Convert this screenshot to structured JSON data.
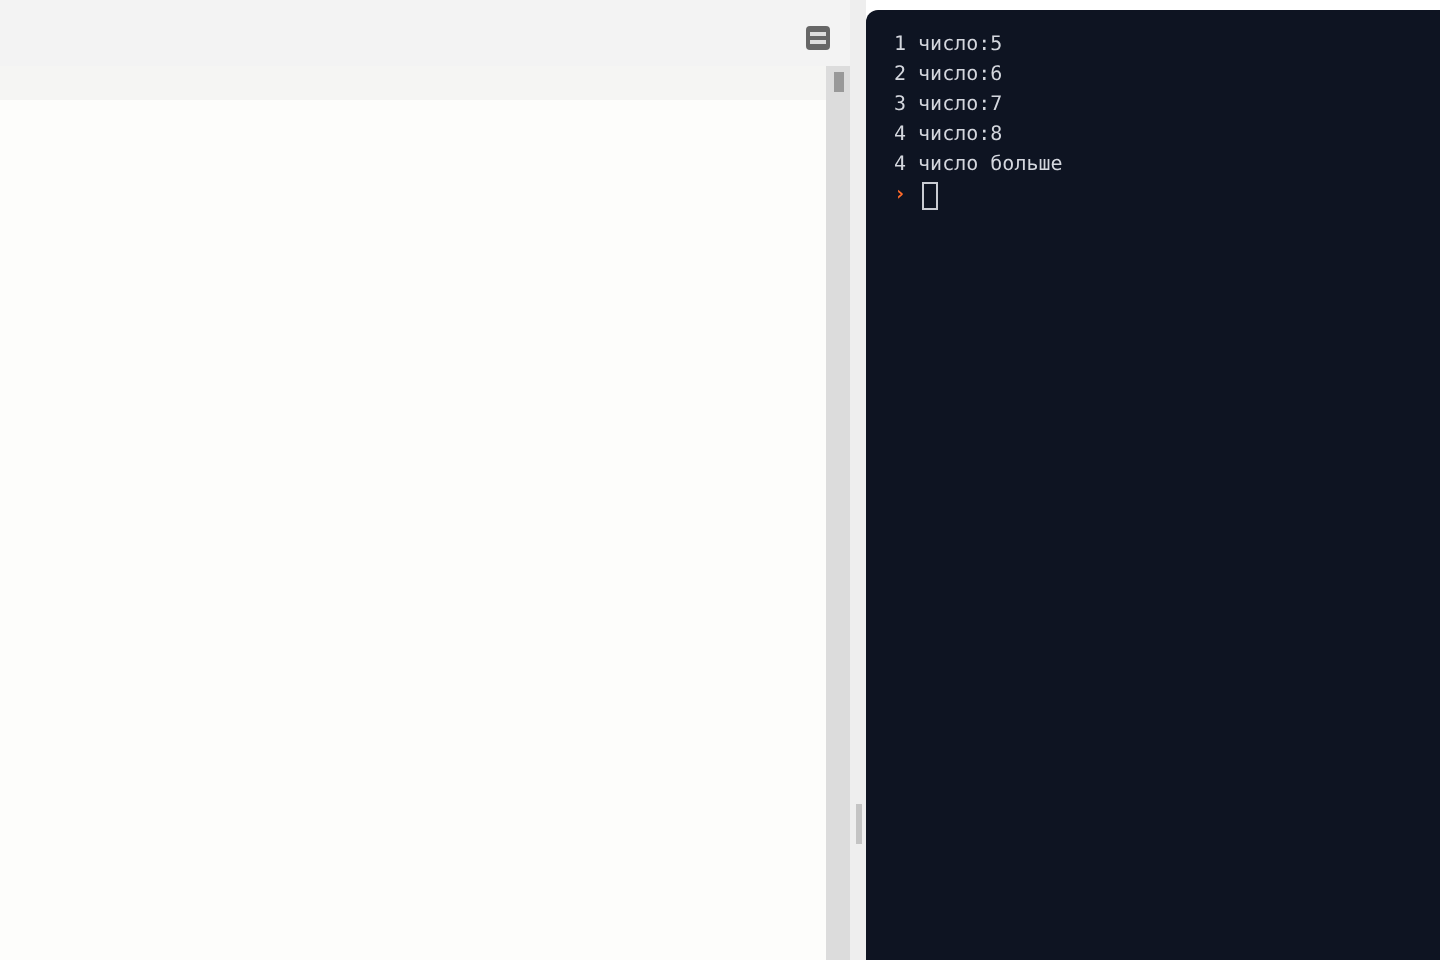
{
  "console": {
    "lines": [
      {
        "text": "1 число:5"
      },
      {
        "text": "2 число:6"
      },
      {
        "text": "3 число:7"
      },
      {
        "text": "4 число:8"
      },
      {
        "text": "4 число больше"
      }
    ],
    "prompt": "›"
  }
}
